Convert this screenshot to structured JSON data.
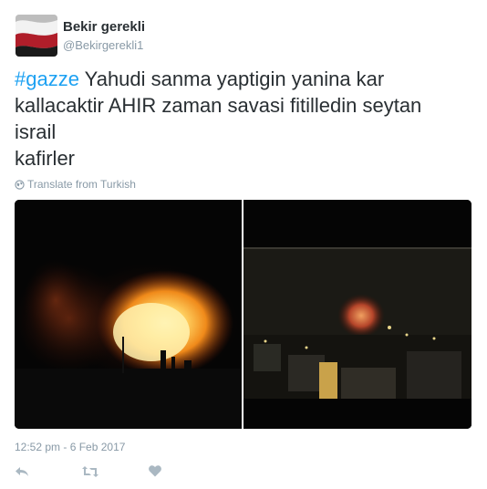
{
  "user": {
    "name": "Bekir gerekli",
    "handle": "@Bekirgerekli1",
    "avatar_icon": "flag-avatar-icon"
  },
  "tweet": {
    "hashtag": "#gazze",
    "lines": [
      " Yahudi sanma yaptigin yanina kar",
      "kallacaktir AHIR zaman savasi fitilledin seytan",
      "israil",
      "kafirler"
    ],
    "translate_label": "Translate from Turkish",
    "timestamp": "12:52 pm - 6 Feb 2017"
  },
  "colors": {
    "hashtag": "#1da1f2",
    "text": "#292f33",
    "muted": "#8899a6"
  },
  "actions": [
    {
      "name": "reply",
      "icon": "reply-icon"
    },
    {
      "name": "retweet",
      "icon": "retweet-icon"
    },
    {
      "name": "like",
      "icon": "heart-icon"
    }
  ]
}
